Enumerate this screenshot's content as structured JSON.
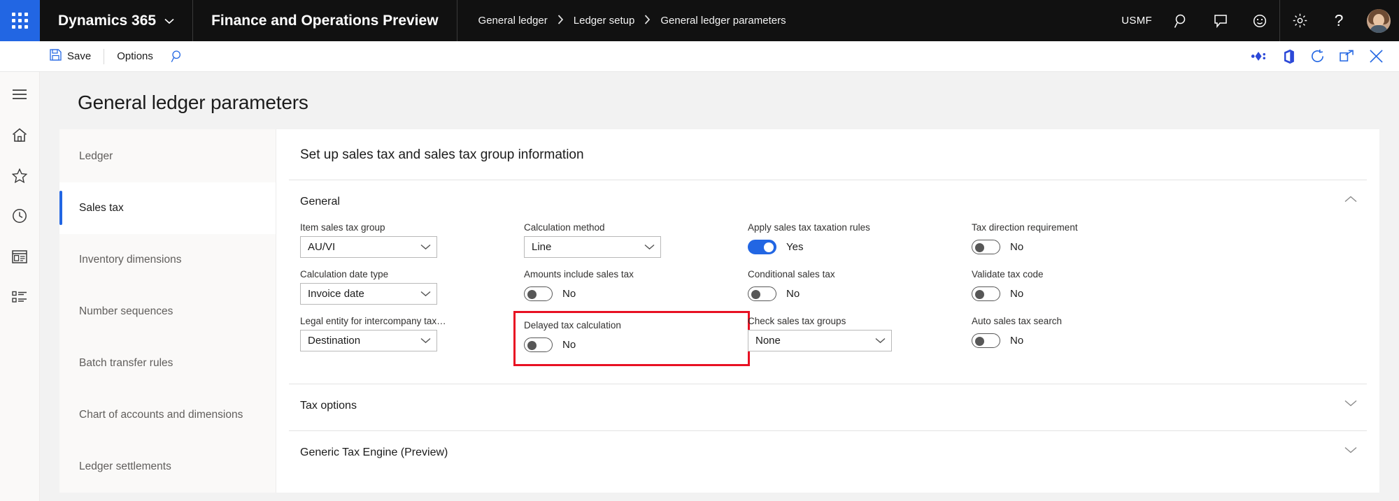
{
  "topbar": {
    "waffle_label": "app-launcher",
    "brand": "Dynamics 365",
    "app_name": "Finance and Operations Preview",
    "breadcrumb": [
      "General ledger",
      "Ledger setup",
      "General ledger parameters"
    ],
    "breadcrumb_separator": "›",
    "company": "USMF",
    "icons": [
      "search-icon",
      "feedback-icon",
      "smiley-icon",
      "gear-icon",
      "help-icon"
    ],
    "help_glyph": "?"
  },
  "toolbar": {
    "save_label": "Save",
    "options_label": "Options",
    "search_icon": "search-icon",
    "right_icons": [
      "powerapps-icon",
      "office-icon",
      "refresh-icon",
      "open-in-new-window-icon",
      "close-icon"
    ]
  },
  "rail": {
    "items": [
      {
        "name": "hamburger-menu-icon"
      },
      {
        "name": "home-icon"
      },
      {
        "name": "favorites-star-icon"
      },
      {
        "name": "recent-clock-icon"
      },
      {
        "name": "workspaces-icon"
      },
      {
        "name": "modules-list-icon"
      }
    ]
  },
  "page": {
    "title": "General ledger parameters"
  },
  "tabs": [
    {
      "label": "Ledger",
      "selected": false
    },
    {
      "label": "Sales tax",
      "selected": true
    },
    {
      "label": "Inventory dimensions",
      "selected": false
    },
    {
      "label": "Number sequences",
      "selected": false
    },
    {
      "label": "Batch transfer rules",
      "selected": false
    },
    {
      "label": "Chart of accounts and dimensions",
      "selected": false
    },
    {
      "label": "Ledger settlements",
      "selected": false
    }
  ],
  "panel": {
    "header": "Set up sales tax and sales tax group information",
    "sections": [
      {
        "title": "General",
        "expanded": true,
        "chevron": "chevron-up-icon"
      },
      {
        "title": "Tax options",
        "expanded": false,
        "chevron": "chevron-down-icon"
      },
      {
        "title": "Generic Tax Engine (Preview)",
        "expanded": false,
        "chevron": "chevron-down-icon"
      }
    ]
  },
  "general_fields": {
    "col1": [
      {
        "label": "Item sales tax group",
        "type": "select",
        "value": "AU/VI"
      },
      {
        "label": "Calculation date type",
        "type": "select",
        "value": "Invoice date"
      },
      {
        "label": "Legal entity for intercompany tax post...",
        "type": "select",
        "value": "Destination"
      }
    ],
    "col2": [
      {
        "label": "Calculation method",
        "type": "select",
        "value": "Line"
      },
      {
        "label": "Amounts include sales tax",
        "type": "toggle",
        "value": "No",
        "on": false
      },
      {
        "label": "Delayed tax calculation",
        "type": "toggle",
        "value": "No",
        "on": false,
        "highlighted": true
      }
    ],
    "col3": [
      {
        "label": "Apply sales tax taxation rules",
        "type": "toggle",
        "value": "Yes",
        "on": true
      },
      {
        "label": "Conditional sales tax",
        "type": "toggle",
        "value": "No",
        "on": false
      },
      {
        "label": "Check sales tax groups",
        "type": "select",
        "value": "None"
      }
    ],
    "col4": [
      {
        "label": "Tax direction requirement",
        "type": "toggle",
        "value": "No",
        "on": false
      },
      {
        "label": "Validate tax code",
        "type": "toggle",
        "value": "No",
        "on": false
      },
      {
        "label": "Auto sales tax search",
        "type": "toggle",
        "value": "No",
        "on": false
      }
    ]
  },
  "colors": {
    "accent": "#2266E3",
    "topbar_bg": "#111111",
    "highlight": "#E81123",
    "canvas_bg": "#f2f2f2"
  }
}
